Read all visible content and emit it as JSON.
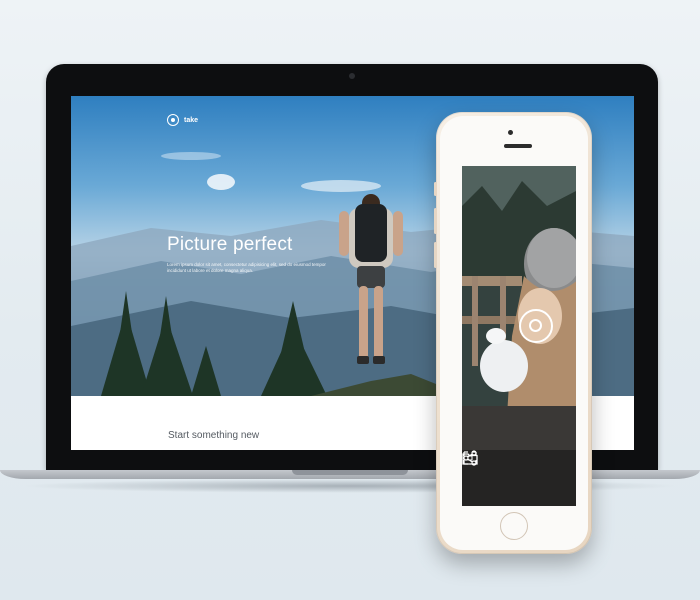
{
  "laptop_site": {
    "brand": "take",
    "side_caption": "",
    "headline": "Picture perfect",
    "subtext": "Lorem ipsum dolor sit amet, consectetur adipisicing elit, sed do eiusmod tempor incididunt ut labore et dolore magna aliqua.",
    "section_title": "Start something new"
  },
  "phone_app": {
    "icons": [
      "camera-ring-icon",
      "folder-icon",
      "grid-icon",
      "share-icon"
    ]
  },
  "colors": {
    "laptop_bezel": "#0d0e10",
    "phone_body": "#efe2d2",
    "accent_white": "#ffffff"
  }
}
